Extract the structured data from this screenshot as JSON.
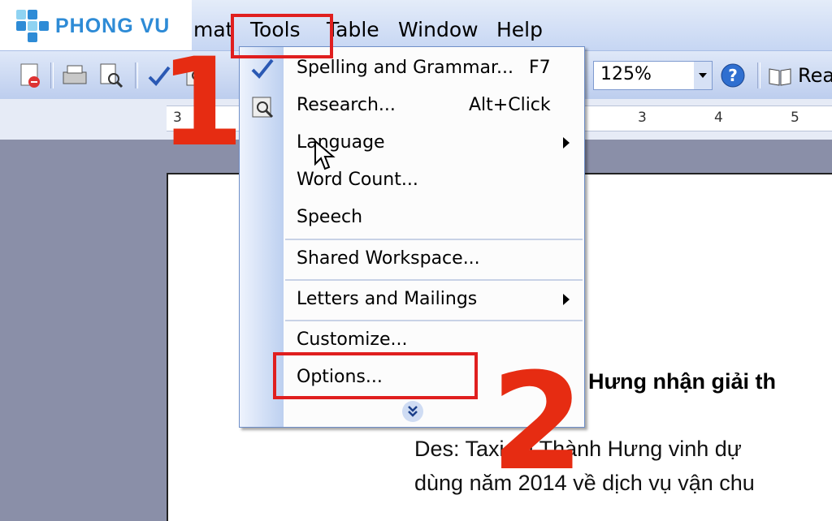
{
  "logo": {
    "text": "PHONG VU"
  },
  "menubar": {
    "format_partial": "mat",
    "tools": "Tools",
    "table": "Table",
    "window": "Window",
    "help": "Help"
  },
  "toolbar": {
    "zoom": "125%",
    "read_partial": "Rea"
  },
  "ruler": {
    "marks": [
      "3",
      "3",
      "4",
      "5"
    ]
  },
  "tools_menu": {
    "items": [
      {
        "label": "Spelling and Grammar...",
        "shortcut": "F7"
      },
      {
        "label": "Research...",
        "shortcut": "Alt+Click"
      },
      {
        "label": "Language"
      },
      {
        "label": "Word Count..."
      },
      {
        "label": "Speech"
      },
      {
        "label": "Shared Workspace..."
      },
      {
        "label": "Letters and Mailings"
      },
      {
        "label": "Customize..."
      },
      {
        "label": "Options..."
      }
    ]
  },
  "document": {
    "title_partial": "h Hưng nhận giải th",
    "line1": "Des: Taxi tải Thành Hưng vinh dự",
    "line2": "dùng năm 2014 về dịch vụ vận chu"
  },
  "annotations": {
    "step1": "1",
    "step2": "2"
  },
  "colors": {
    "annotation_red": "#e01f1f",
    "menu_strip": "#bdd0f0",
    "brand_blue": "#2e8bd6"
  }
}
